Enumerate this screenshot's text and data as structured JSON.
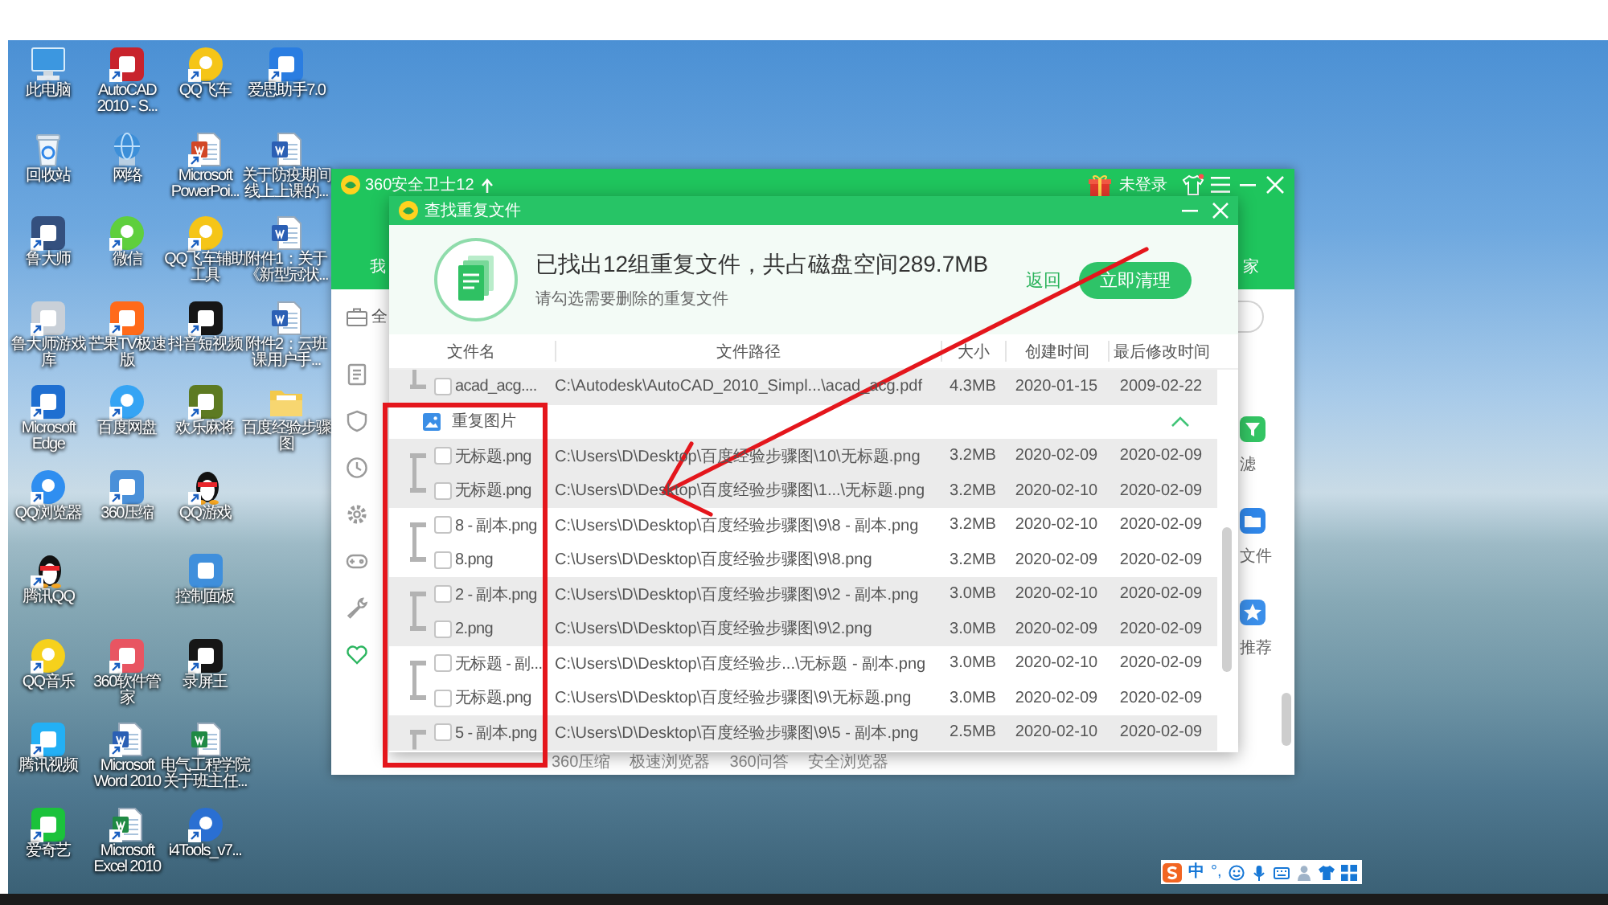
{
  "desktop": {
    "rows": [
      [
        {
          "label": "此电脑"
        },
        {
          "label": "AutoCAD 2010 - S..."
        },
        {
          "label": "QQ飞车"
        },
        {
          "label": "爱思助手7.0"
        }
      ],
      [
        {
          "label": "回收站"
        },
        {
          "label": "网络"
        },
        {
          "label": "Microsoft PowerPoi..."
        },
        {
          "label": "关于防疫期间线上上课的..."
        }
      ],
      [
        {
          "label": "鲁大师"
        },
        {
          "label": "微信"
        },
        {
          "label": "QQ飞车辅助工具"
        },
        {
          "label": "附件1：关于《新型冠状..."
        }
      ],
      [
        {
          "label": "鲁大师游戏库"
        },
        {
          "label": "芒果TV极速版"
        },
        {
          "label": "抖音短视频"
        },
        {
          "label": "附件2：云班课用户手..."
        }
      ],
      [
        {
          "label": "Microsoft Edge"
        },
        {
          "label": "百度网盘"
        },
        {
          "label": "欢乐麻将"
        },
        {
          "label": "百度经验步骤图"
        }
      ],
      [
        {
          "label": "QQ浏览器"
        },
        {
          "label": "360压缩"
        },
        {
          "label": "QQ游戏"
        }
      ],
      [
        {
          "label": "腾讯QQ"
        },
        null,
        {
          "label": "控制面板"
        }
      ],
      [
        {
          "label": "QQ音乐"
        },
        {
          "label": "360软件管家"
        },
        {
          "label": "录屏王"
        }
      ],
      [
        {
          "label": "腾讯视频"
        },
        {
          "label": "Microsoft Word 2010"
        },
        {
          "label": "电气工程学院关于班主任..."
        }
      ],
      [
        {
          "label": "爱奇艺"
        },
        {
          "label": "Microsoft Excel 2010"
        },
        {
          "label": "i4Tools_v7..."
        }
      ]
    ]
  },
  "main_window": {
    "title": "360安全卫士12",
    "user_status": "未登录",
    "nav": [
      {
        "label": "我"
      },
      {
        "label": "家"
      }
    ],
    "toolbar": {
      "label": "全"
    },
    "sidebar": {
      "items": [
        {
          "selected": false
        },
        {
          "selected": false
        },
        {
          "selected": false
        },
        {
          "selected": false
        },
        {
          "selected": false
        },
        {
          "selected": false
        },
        {
          "selected": true
        }
      ]
    },
    "tool_tiles": [
      {
        "label": "滤"
      },
      {
        "label": "文件"
      },
      {
        "label": "推荐"
      }
    ],
    "footer_links": [
      "360压缩",
      "极速浏览器",
      "360问答",
      "安全浏览器"
    ]
  },
  "dialog": {
    "title": "查找重复文件",
    "summary": "已找出12组重复文件，共占磁盘空间289.7MB",
    "hint": "请勾选需要删除的重复文件",
    "back_link": "返回",
    "clean_button": "立即清理",
    "table": {
      "columns": [
        "文件名",
        "文件路径",
        "大小",
        "创建时间",
        "最后修改时间"
      ],
      "rows": [
        {
          "kind": "group",
          "files": [
            {
              "name": "acad_acg....",
              "path": "C:\\Autodesk\\AutoCAD_2010_Simpl...\\acad_acg.pdf",
              "size": "4.3MB",
              "created": "2020-01-15",
              "modified": "2009-02-22",
              "checked": false
            }
          ]
        },
        {
          "kind": "category",
          "label": "重复图片",
          "expanded": true
        },
        {
          "kind": "group",
          "files": [
            {
              "name": "无标题.png",
              "path": "C:\\Users\\D\\Desktop\\百度经验步骤图\\10\\无标题.png",
              "size": "3.2MB",
              "created": "2020-02-09",
              "modified": "2020-02-09",
              "checked": false
            },
            {
              "name": "无标题.png",
              "path": "C:\\Users\\D\\Desktop\\百度经验步骤图\\1...\\无标题.png",
              "size": "3.2MB",
              "created": "2020-02-10",
              "modified": "2020-02-09",
              "checked": false
            }
          ]
        },
        {
          "kind": "group",
          "files": [
            {
              "name": "8 - 副本.png",
              "path": "C:\\Users\\D\\Desktop\\百度经验步骤图\\9\\8 - 副本.png",
              "size": "3.2MB",
              "created": "2020-02-10",
              "modified": "2020-02-09",
              "checked": false
            },
            {
              "name": "8.png",
              "path": "C:\\Users\\D\\Desktop\\百度经验步骤图\\9\\8.png",
              "size": "3.2MB",
              "created": "2020-02-09",
              "modified": "2020-02-09",
              "checked": false
            }
          ]
        },
        {
          "kind": "group",
          "files": [
            {
              "name": "2 - 副本.png",
              "path": "C:\\Users\\D\\Desktop\\百度经验步骤图\\9\\2 - 副本.png",
              "size": "3.0MB",
              "created": "2020-02-10",
              "modified": "2020-02-09",
              "checked": false
            },
            {
              "name": "2.png",
              "path": "C:\\Users\\D\\Desktop\\百度经验步骤图\\9\\2.png",
              "size": "3.0MB",
              "created": "2020-02-09",
              "modified": "2020-02-09",
              "checked": false
            }
          ]
        },
        {
          "kind": "group",
          "files": [
            {
              "name": "无标题 - 副...",
              "path": "C:\\Users\\D\\Desktop\\百度经验步...\\无标题 - 副本.png",
              "size": "3.0MB",
              "created": "2020-02-10",
              "modified": "2020-02-09",
              "checked": false
            },
            {
              "name": "无标题.png",
              "path": "C:\\Users\\D\\Desktop\\百度经验步骤图\\9\\无标题.png",
              "size": "3.0MB",
              "created": "2020-02-09",
              "modified": "2020-02-09",
              "checked": false
            }
          ]
        },
        {
          "kind": "group",
          "files": [
            {
              "name": "5 - 副本.png",
              "path": "C:\\Users\\D\\Desktop\\百度经验步骤图\\9\\5 - 副本.png",
              "size": "2.5MB",
              "created": "2020-02-10",
              "modified": "2020-02-09",
              "checked": false
            }
          ]
        }
      ]
    }
  },
  "annotations": {
    "highlight_box": true,
    "arrow": true
  },
  "ime_bar": {
    "mode": "中",
    "punctuation": "°,"
  }
}
